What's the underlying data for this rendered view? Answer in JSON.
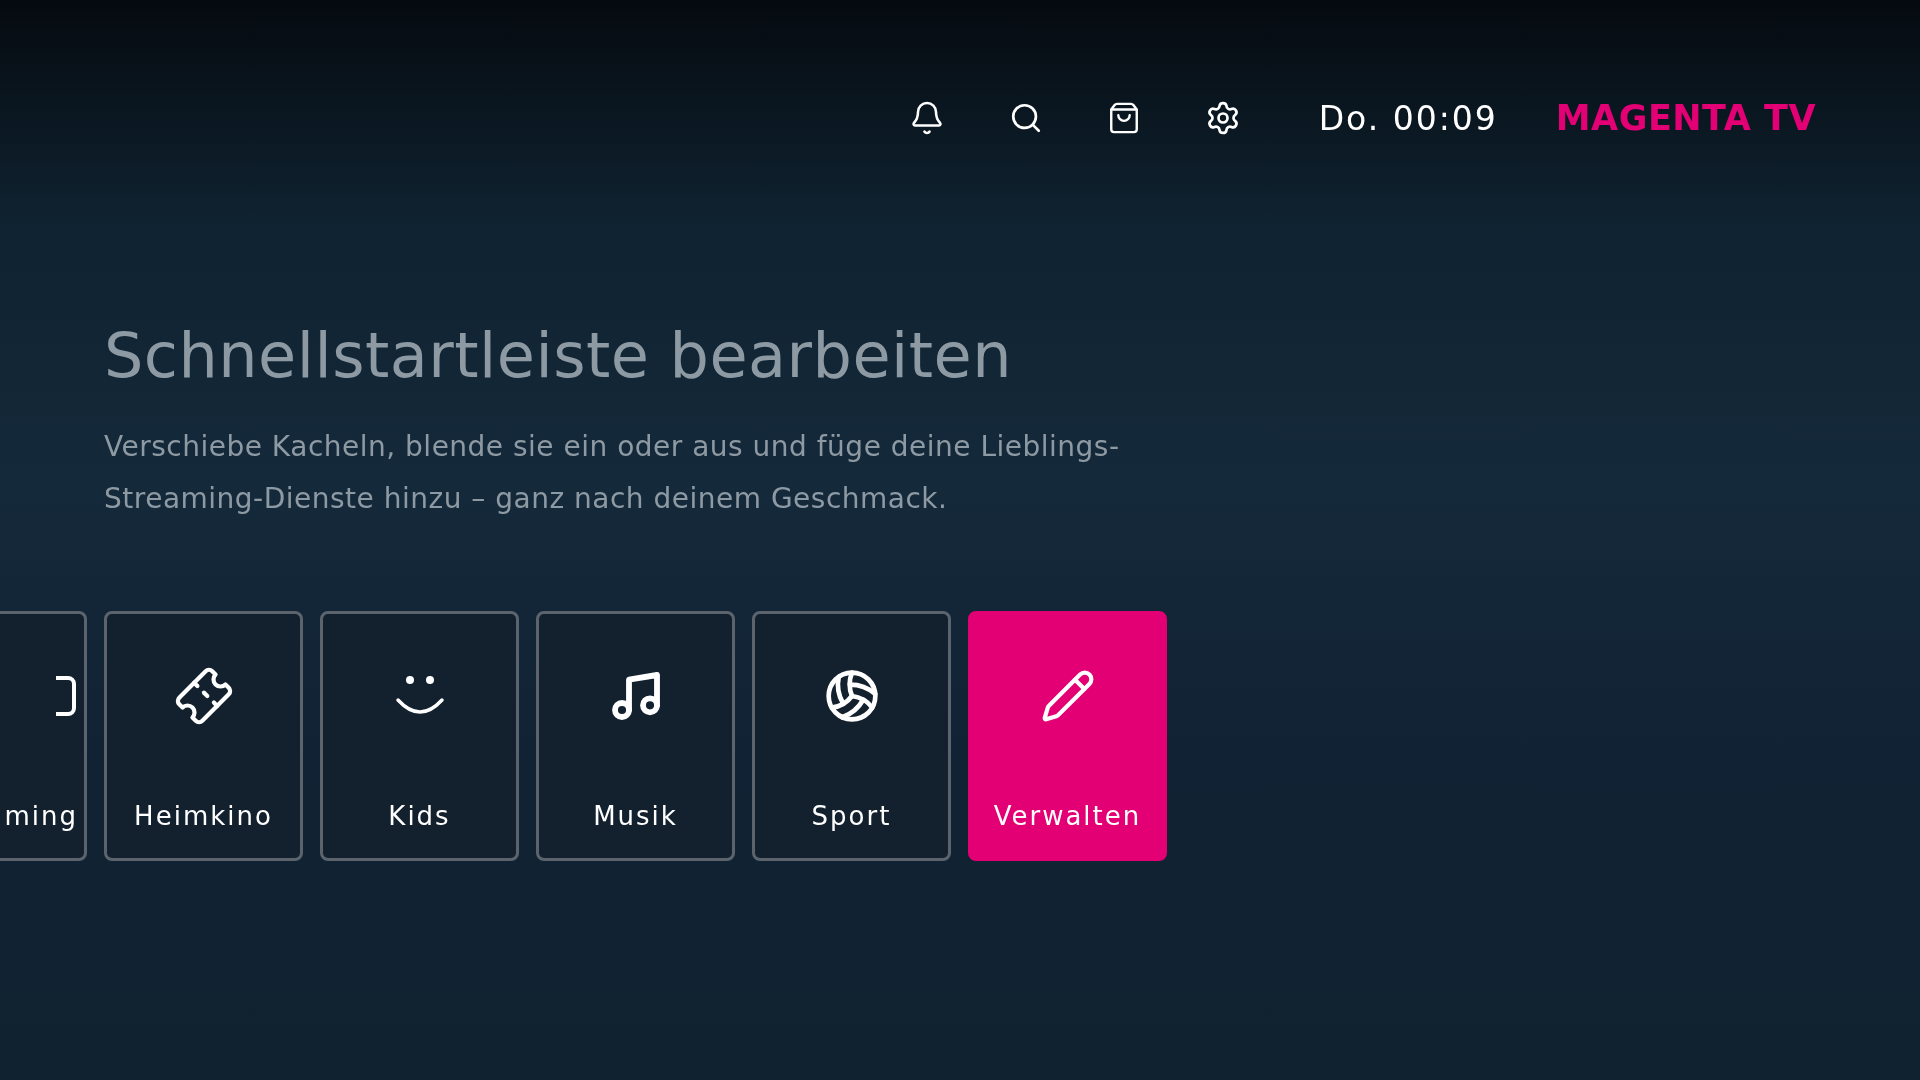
{
  "header": {
    "clock": "Do. 00:09",
    "logo": "MAGENTA TV"
  },
  "title": "Schnellstartleiste bearbeiten",
  "description": "Verschiebe Kacheln, blende sie ein oder aus und füge deine Lieblings-Streaming-Dienste hinzu – ganz nach deinem Geschmack.",
  "tiles": [
    {
      "label": "ming",
      "kind": "screen",
      "selected": false
    },
    {
      "label": "Heimkino",
      "kind": "ticket",
      "selected": false
    },
    {
      "label": "Kids",
      "kind": "smile",
      "selected": false
    },
    {
      "label": "Musik",
      "kind": "music",
      "selected": false
    },
    {
      "label": "Sport",
      "kind": "ball",
      "selected": false
    },
    {
      "label": "Verwalten",
      "kind": "pencil",
      "selected": true
    }
  ]
}
